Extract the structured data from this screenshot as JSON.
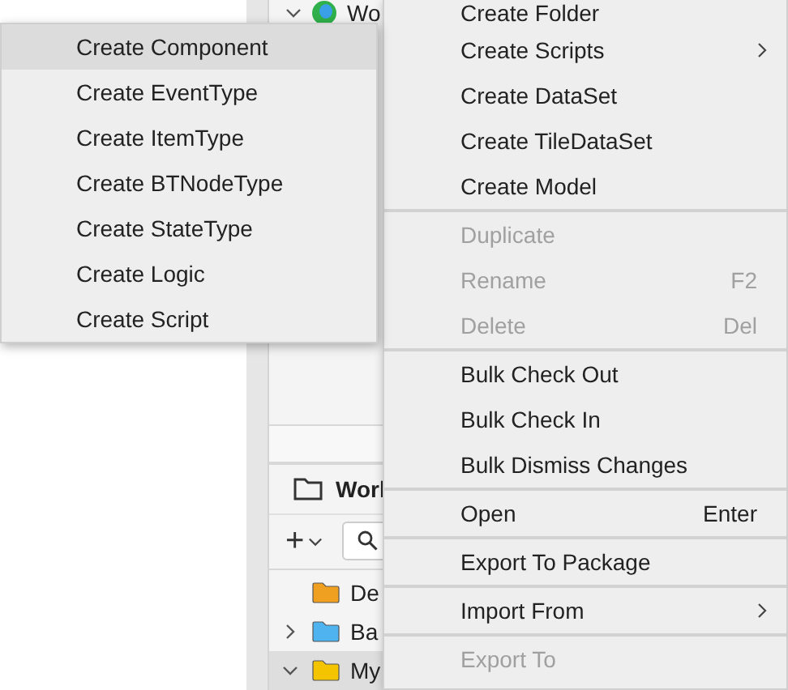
{
  "explorer": {
    "top_item": {
      "label": "Wo",
      "expanded": true
    },
    "panel_title": "Worl",
    "add_button": "+",
    "tree": [
      {
        "label": "De",
        "color": "#f0a020",
        "selected": false
      },
      {
        "label": "Ba",
        "color": "#4fb3ef",
        "expanded": false,
        "selected": false
      },
      {
        "label": "My",
        "color": "#f5c400",
        "expanded": true,
        "selected": true
      }
    ]
  },
  "context_menu": {
    "groups": [
      [
        {
          "label": "Create Folder",
          "disabled": false
        },
        {
          "label": "Create Scripts",
          "disabled": false,
          "submenu": true
        },
        {
          "label": "Create DataSet",
          "disabled": false
        },
        {
          "label": "Create TileDataSet",
          "disabled": false
        },
        {
          "label": "Create Model",
          "disabled": false
        }
      ],
      [
        {
          "label": "Duplicate",
          "disabled": true
        },
        {
          "label": "Rename",
          "shortcut": "F2",
          "disabled": true
        },
        {
          "label": "Delete",
          "shortcut": "Del",
          "disabled": true
        }
      ],
      [
        {
          "label": "Bulk Check Out",
          "disabled": false
        },
        {
          "label": "Bulk Check In",
          "disabled": false
        },
        {
          "label": "Bulk Dismiss Changes",
          "disabled": false
        }
      ],
      [
        {
          "label": "Open",
          "shortcut": "Enter",
          "disabled": false
        }
      ],
      [
        {
          "label": "Export To Package",
          "disabled": false
        }
      ],
      [
        {
          "label": "Import From",
          "disabled": false,
          "submenu": true
        }
      ],
      [
        {
          "label": "Export To",
          "disabled": true
        }
      ]
    ]
  },
  "submenu": {
    "items": [
      {
        "label": "Create Component",
        "selected": true
      },
      {
        "label": "Create EventType",
        "selected": false
      },
      {
        "label": "Create ItemType",
        "selected": false
      },
      {
        "label": "Create BTNodeType",
        "selected": false
      },
      {
        "label": "Create StateType",
        "selected": false
      },
      {
        "label": "Create Logic",
        "selected": false
      },
      {
        "label": "Create Script",
        "selected": false
      }
    ]
  }
}
